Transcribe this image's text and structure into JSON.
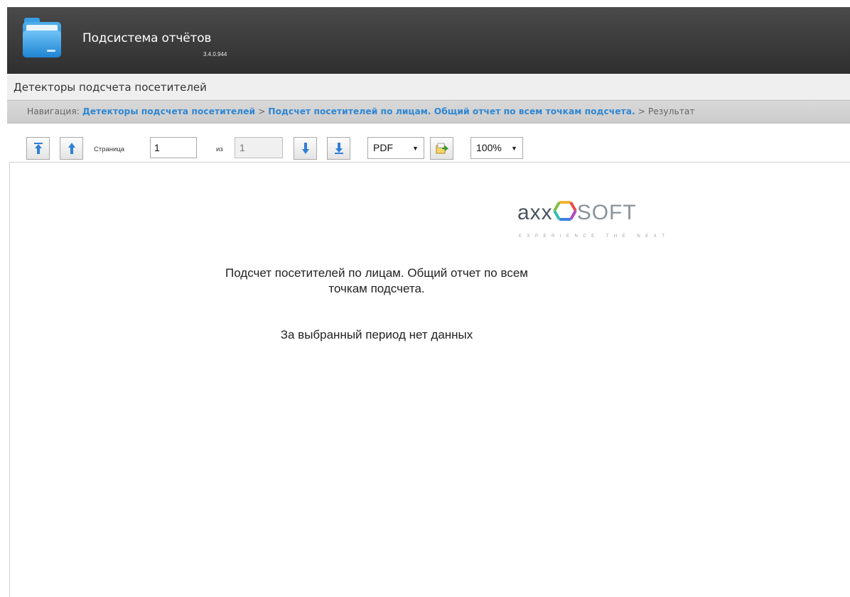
{
  "app": {
    "title": "Подсистема отчётов",
    "version": "3.4.0.944"
  },
  "section": {
    "title": "Детекторы подсчета посетителей"
  },
  "breadcrumb": {
    "prefix": "Навигация:",
    "link1": "Детекторы подсчета посетителей",
    "sep1": ">",
    "link2": "Подсчет посетителей по лицам. Общий отчет по всем точкам подсчета.",
    "sep2": ">",
    "current": "Результат"
  },
  "toolbar": {
    "page_label": "Страница",
    "page_value": "1",
    "of_label": "из",
    "total_pages": "1",
    "export_format": "PDF",
    "zoom": "100%",
    "icons": [
      "first-page-icon",
      "prev-page-icon",
      "next-page-icon",
      "last-page-icon",
      "export-icon"
    ]
  },
  "report": {
    "logo_main": "axx",
    "logo_soft": "SOFT",
    "logo_tagline": "EXPERIENCE THE NEXT",
    "title_line1": "Подсчет посетителей по лицам. Общий отчет по всем",
    "title_line2": "точкам подсчета.",
    "empty_message": "За выбранный период нет данных"
  },
  "colors": {
    "header_bg": "#3b3b3b",
    "link": "#2f86d2",
    "arrow_icon": "#2f7fd6"
  }
}
